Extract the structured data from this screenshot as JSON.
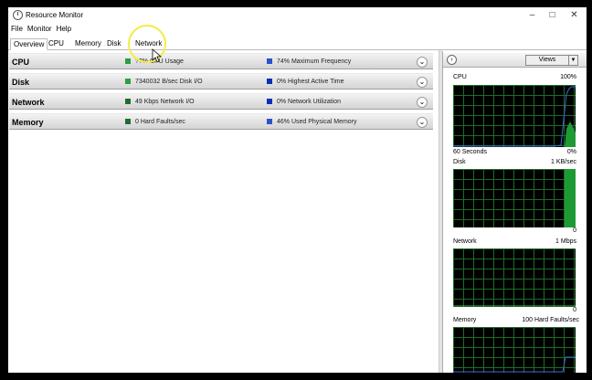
{
  "window": {
    "title": "Resource Monitor",
    "controls": {
      "minimize": "–",
      "maximize": "□",
      "close": "✕"
    }
  },
  "menu": [
    "File",
    "Monitor",
    "Help"
  ],
  "tabs": [
    "Overview",
    "CPU",
    "Memory",
    "Disk",
    "Network"
  ],
  "active_tab": "Overview",
  "panels": [
    {
      "title": "CPU",
      "stat1": "??% CPU Usage",
      "stat2": "74% Maximum Frequency",
      "swatch1": "#2e9e3e",
      "swatch2": "#2a52c9"
    },
    {
      "title": "Disk",
      "stat1": "7340032 B/sec Disk I/O",
      "stat2": "0% Highest Active Time",
      "swatch1": "#2e9e3e",
      "swatch2": "#0a2fb8"
    },
    {
      "title": "Network",
      "stat1": "49 Kbps Network I/O",
      "stat2": "0% Network Utilization",
      "swatch1": "#1e6e2a",
      "swatch2": "#0a2fb8"
    },
    {
      "title": "Memory",
      "stat1": "0 Hard Faults/sec",
      "stat2": "46% Used Physical Memory",
      "swatch1": "#1e6e2a",
      "swatch2": "#2a52c9"
    }
  ],
  "right_pane": {
    "expand_icon": "›",
    "views_label": "Views",
    "views_dropdown_icon": "▼",
    "graphs": [
      {
        "name": "CPU",
        "max": "100%",
        "footer_left": "60 Seconds",
        "footer_right": "0%"
      },
      {
        "name": "Disk",
        "max": "1 KB/sec",
        "footer_right": "0"
      },
      {
        "name": "Network",
        "max": "1 Mbps",
        "footer_right": "0"
      },
      {
        "name": "Memory",
        "max": "100 Hard Faults/sec"
      }
    ]
  },
  "colors": {
    "graph_bg": "#000000",
    "grid": "#1e6b28",
    "cpu_line": "#2a8f3e",
    "disk_fill": "#1e9a35",
    "highlight_circle": "#f2ec4a"
  }
}
